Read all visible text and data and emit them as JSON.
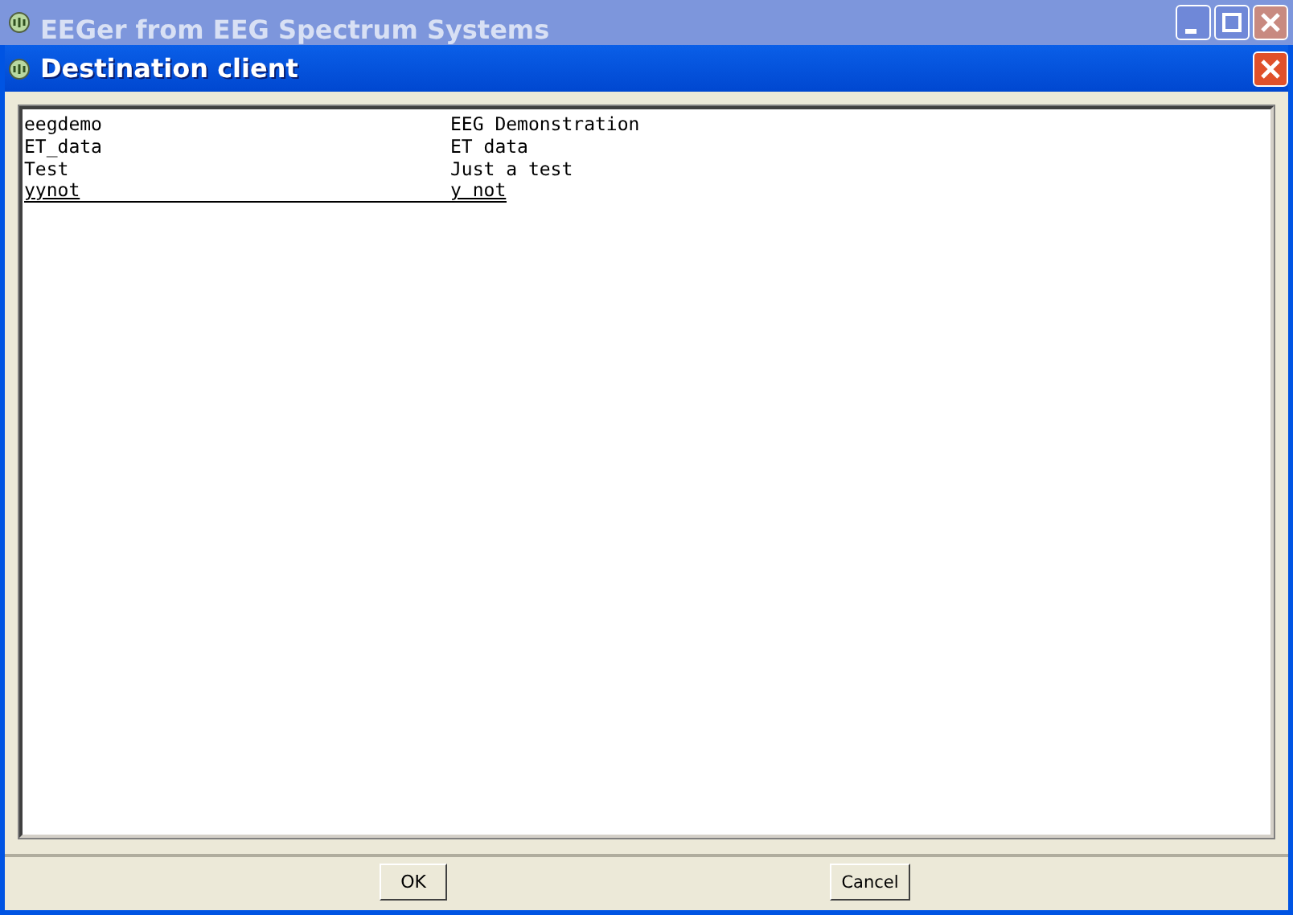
{
  "parent_window": {
    "title": "EEGer from EEG Spectrum Systems"
  },
  "dialog": {
    "title": "Destination client"
  },
  "clients": [
    {
      "name": "eegdemo",
      "description": "EEG Demonstration",
      "selected": false
    },
    {
      "name": "ET_data",
      "description": "ET data",
      "selected": false
    },
    {
      "name": "Test",
      "description": "Just a test",
      "selected": false
    },
    {
      "name": "yynot",
      "description": "y not",
      "selected": true
    }
  ],
  "buttons": [
    "OK",
    "Cancel"
  ]
}
